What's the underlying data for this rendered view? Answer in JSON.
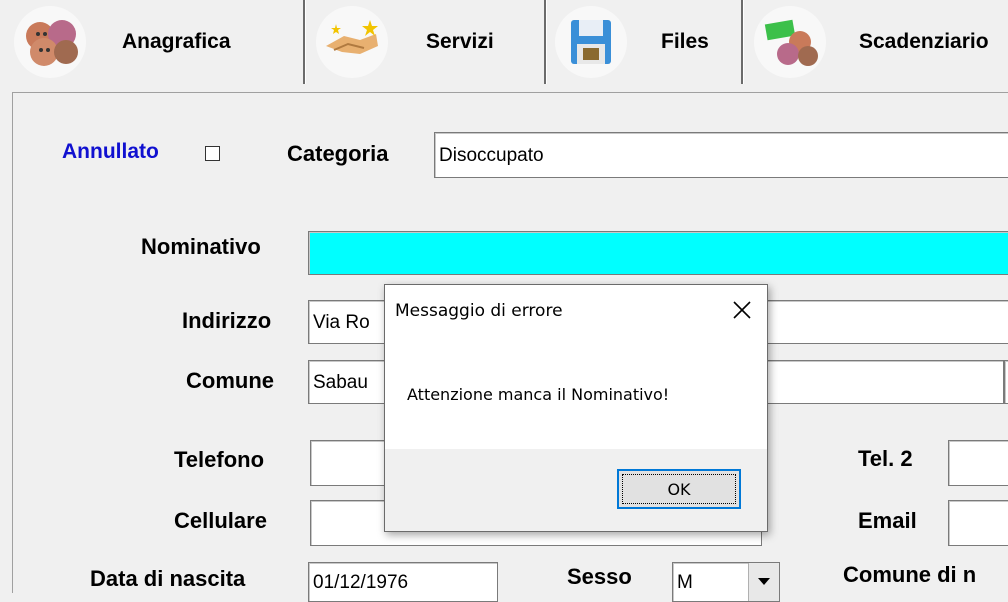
{
  "tabs": [
    {
      "label": "Anagrafica",
      "icon": "people-faces-icon"
    },
    {
      "label": "Servizi",
      "icon": "handshake-sparkle-icon"
    },
    {
      "label": "Files",
      "icon": "floppy-disk-icon"
    },
    {
      "label": "Scadenziario",
      "icon": "money-people-icon"
    }
  ],
  "form": {
    "annullato_label": "Annullato",
    "categoria_label": "Categoria",
    "categoria_value": "Disoccupato",
    "nominativo_label": "Nominativo",
    "nominativo_value": "",
    "indirizzo_label": "Indirizzo",
    "indirizzo_value": "Via Ro",
    "comune_label": "Comune",
    "comune_value": "Sabau",
    "telefono_label": "Telefono",
    "tel2_label": "Tel. 2",
    "cellulare_label": "Cellulare",
    "email_label": "Email",
    "data_nascita_label": "Data di nascita",
    "data_nascita_value": "01/12/1976",
    "sesso_label": "Sesso",
    "sesso_value": "M",
    "comune_nascita_label": "Comune di n"
  },
  "dialog": {
    "title": "Messaggio di errore",
    "message": "Attenzione manca il Nominativo!",
    "ok_label": "OK"
  },
  "colors": {
    "nominativo_highlight": "#00ffff",
    "annullato_label": "#1010d0",
    "dialog_button_focus": "#0078d7"
  }
}
